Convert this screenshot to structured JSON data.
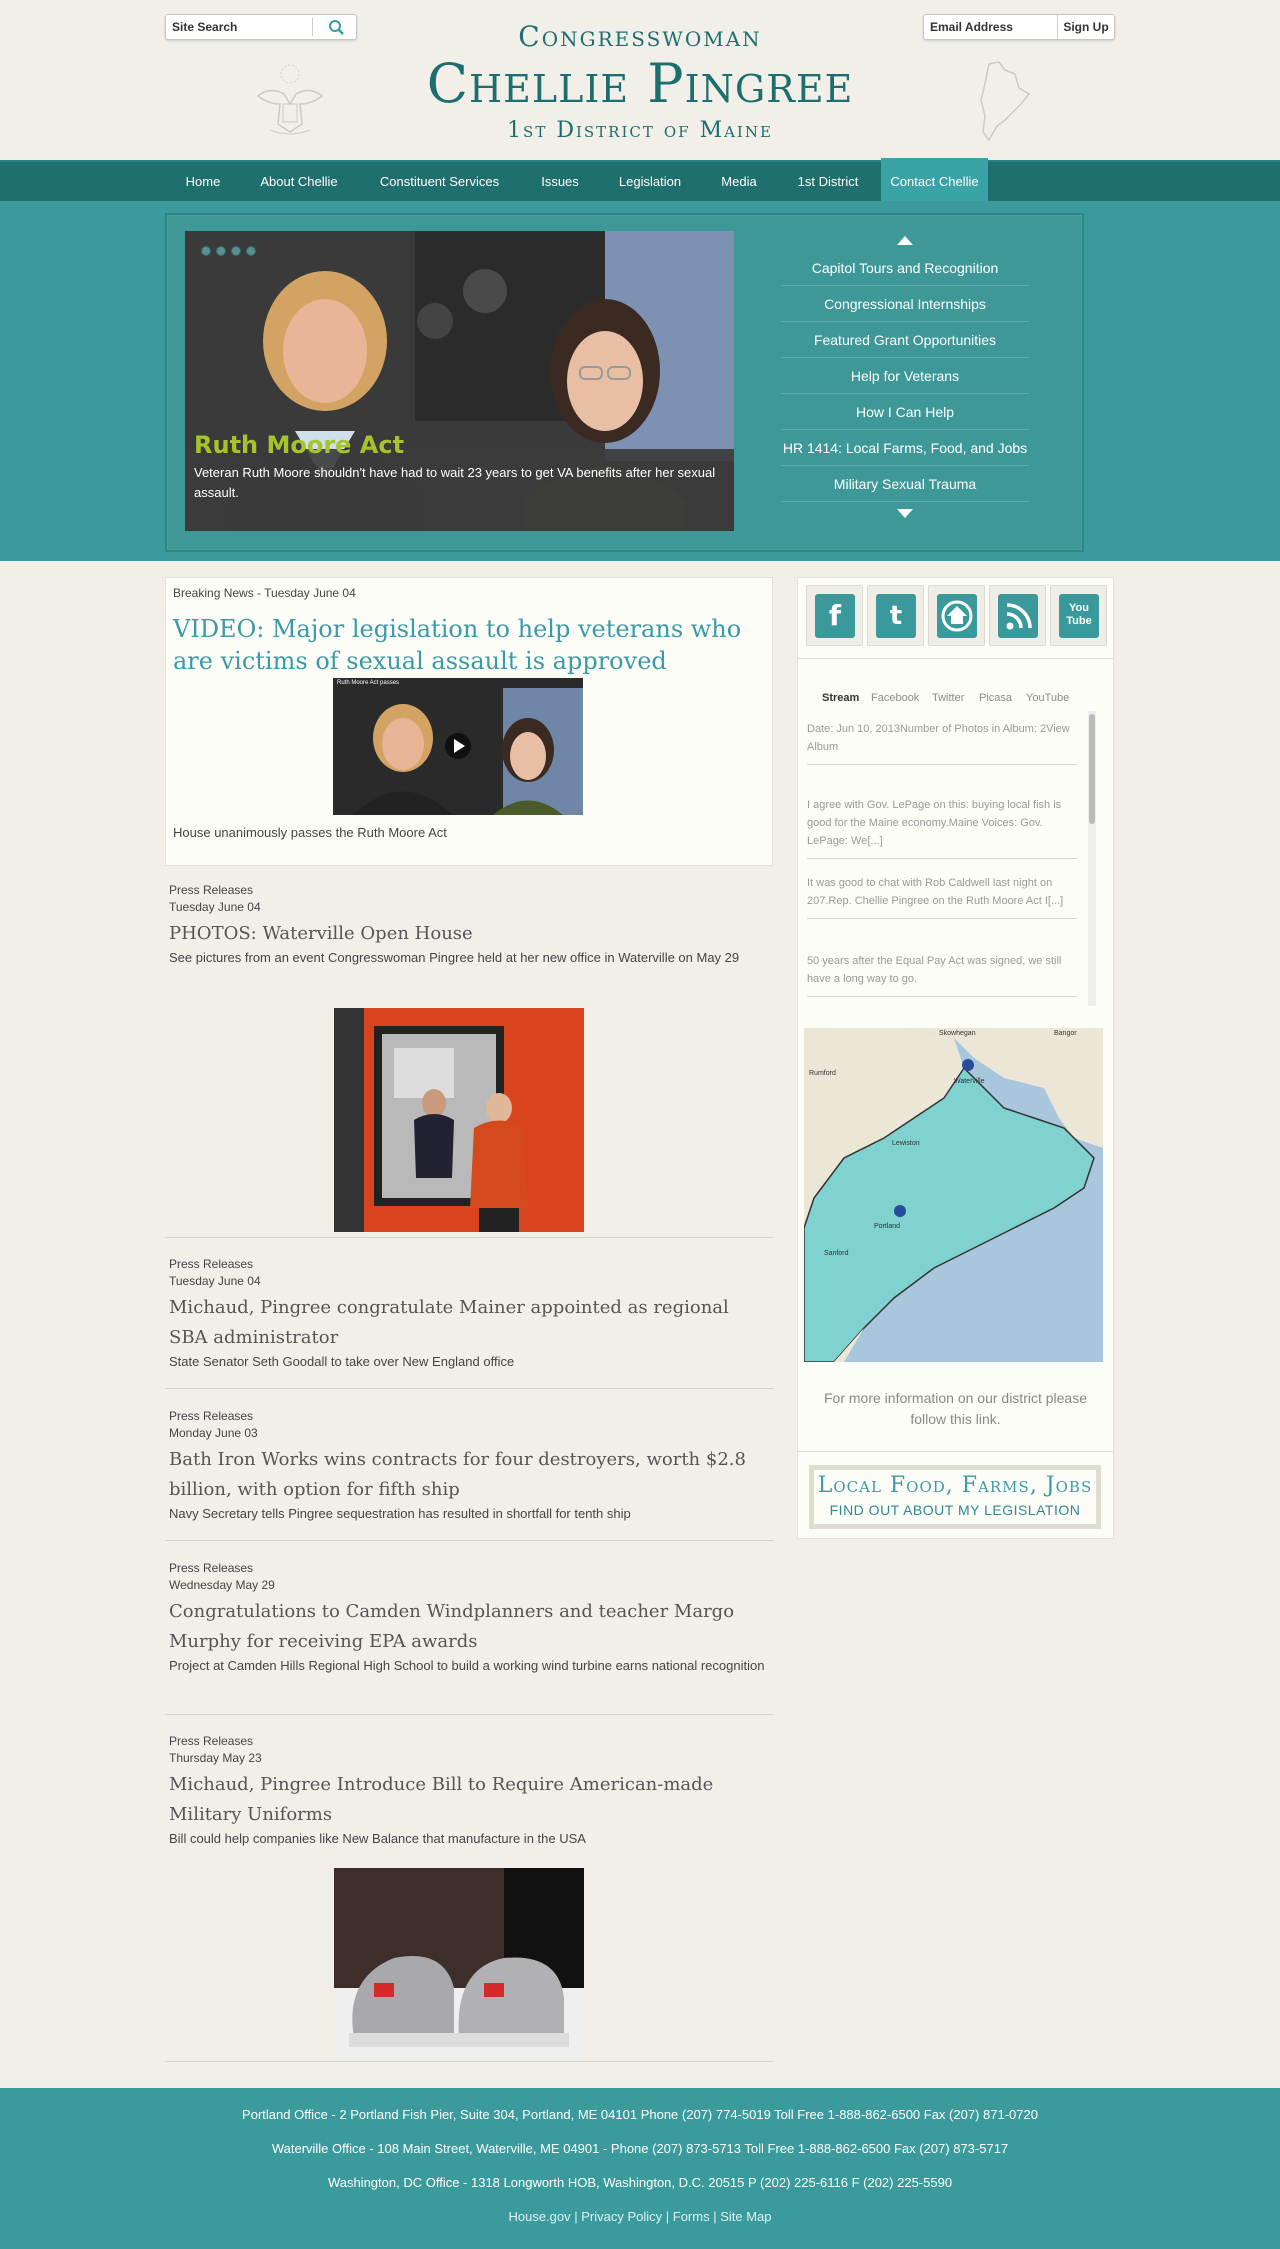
{
  "header": {
    "search_placeholder": "Site Search",
    "email_placeholder": "Email Address",
    "signup_label": "Sign Up",
    "title_small": "Congresswoman",
    "title_name": "Chellie Pingree",
    "title_district": "1st District of Maine"
  },
  "nav": {
    "items": [
      "Home",
      "About Chellie",
      "Constituent Services",
      "Issues",
      "Legislation",
      "Media",
      "1st District",
      "Contact Chellie"
    ],
    "active": "Contact Chellie"
  },
  "hero": {
    "slide_title": "Ruth Moore Act",
    "slide_text": "Veteran Ruth Moore shouldn't have had to wait 23 years to get VA benefits after her sexual assault.",
    "links": [
      "Capitol Tours and Recognition",
      "Congressional Internships",
      "Featured Grant Opportunities",
      "Help for Veterans",
      "How I Can Help",
      "HR 1414: Local Farms, Food, and Jobs",
      "Military Sexual Trauma"
    ]
  },
  "breaking": {
    "label": "Breaking News - Tuesday June 04",
    "headline": "VIDEO: Major legislation to help veterans who are victims of sexual assault is approved",
    "video_title": "Ruth Moore Act passes",
    "caption": "House unanimously passes the Ruth Moore Act"
  },
  "news": [
    {
      "category": "Press Releases",
      "date": "Tuesday June 04",
      "headline": "PHOTOS: Waterville Open House",
      "summary": "See pictures from an event Congresswoman Pingree held at her new office in Waterville on May 29"
    },
    {
      "category": "Press Releases",
      "date": "Tuesday June 04",
      "headline": "Michaud, Pingree congratulate Mainer appointed as regional SBA administrator",
      "summary": "State Senator Seth Goodall to take over New England office"
    },
    {
      "category": "Press Releases",
      "date": "Monday June 03",
      "headline": "Bath Iron Works wins contracts for four destroyers, worth $2.8 billion, with option for fifth ship",
      "summary": "Navy Secretary tells Pingree sequestration has resulted in shortfall for tenth ship"
    },
    {
      "category": "Press Releases",
      "date": "Wednesday May 29",
      "headline": "Congratulations to Camden Windplanners and teacher Margo Murphy for receiving EPA awards",
      "summary": "Project at Camden Hills Regional High School to build a working wind turbine earns national recognition"
    },
    {
      "category": "Press Releases",
      "date": "Thursday May 23",
      "headline": "Michaud, Pingree Introduce Bill to Require American-made Military Uniforms",
      "summary": "Bill could help companies like New Balance that manufacture in the USA"
    }
  ],
  "sidebar": {
    "social": [
      "facebook-icon",
      "twitter-icon",
      "house-icon",
      "rss-icon",
      "youtube-icon"
    ],
    "youtube_text": "You Tube",
    "tabs": [
      "Stream",
      "Facebook",
      "Twitter",
      "Picasa",
      "YouTube"
    ],
    "active_tab": "Stream",
    "stream": [
      "Date: Jun 10, 2013Number of Photos in Album: 2View Album",
      "I agree with Gov. LePage on this: buying local fish is good for the Maine economy.Maine Voices: Gov. LePage: We[...]",
      "It was good to chat with Rob Caldwell last night on 207.Rep. Chellie Pingree on the Ruth Moore Act I[...]",
      "50 years after the Equal Pay Act was signed, we still have a long way to go."
    ],
    "map_labels": [
      "Skowhegan",
      "Bangor",
      "Rumford",
      "Waterville",
      "Lewiston",
      "Portland",
      "Sanford"
    ],
    "map_note": "For more information on our district please follow this link.",
    "promo_line1": "Local Food, Farms, Jobs",
    "promo_line2": "FIND OUT ABOUT MY LEGISLATION"
  },
  "footer": {
    "portland": "Portland Office - 2 Portland Fish Pier, Suite 304, Portland, ME  04101 Phone (207) 774-5019 Toll Free 1-888-862-6500 Fax (207) 871-0720",
    "waterville": "Waterville Office - 108 Main Street, Waterville, ME 04901 - Phone (207) 873-5713 Toll Free 1-888-862-6500 Fax (207) 873-5717",
    "dc": "Washington, DC Office - 1318 Longworth HOB, Washington, D.C. 20515 P (202) 225-6116 F (202) 225-5590",
    "links": [
      "House.gov",
      "Privacy Policy",
      "Forms",
      "Site Map"
    ]
  },
  "colors": {
    "teal": "#3b9a9b",
    "dark_teal": "#1f6f6f",
    "title_teal": "#1d6e6e",
    "headline_teal": "#3a9aa6",
    "slide_title_green": "#a6c32b",
    "page_bg": "#f1efe8"
  }
}
